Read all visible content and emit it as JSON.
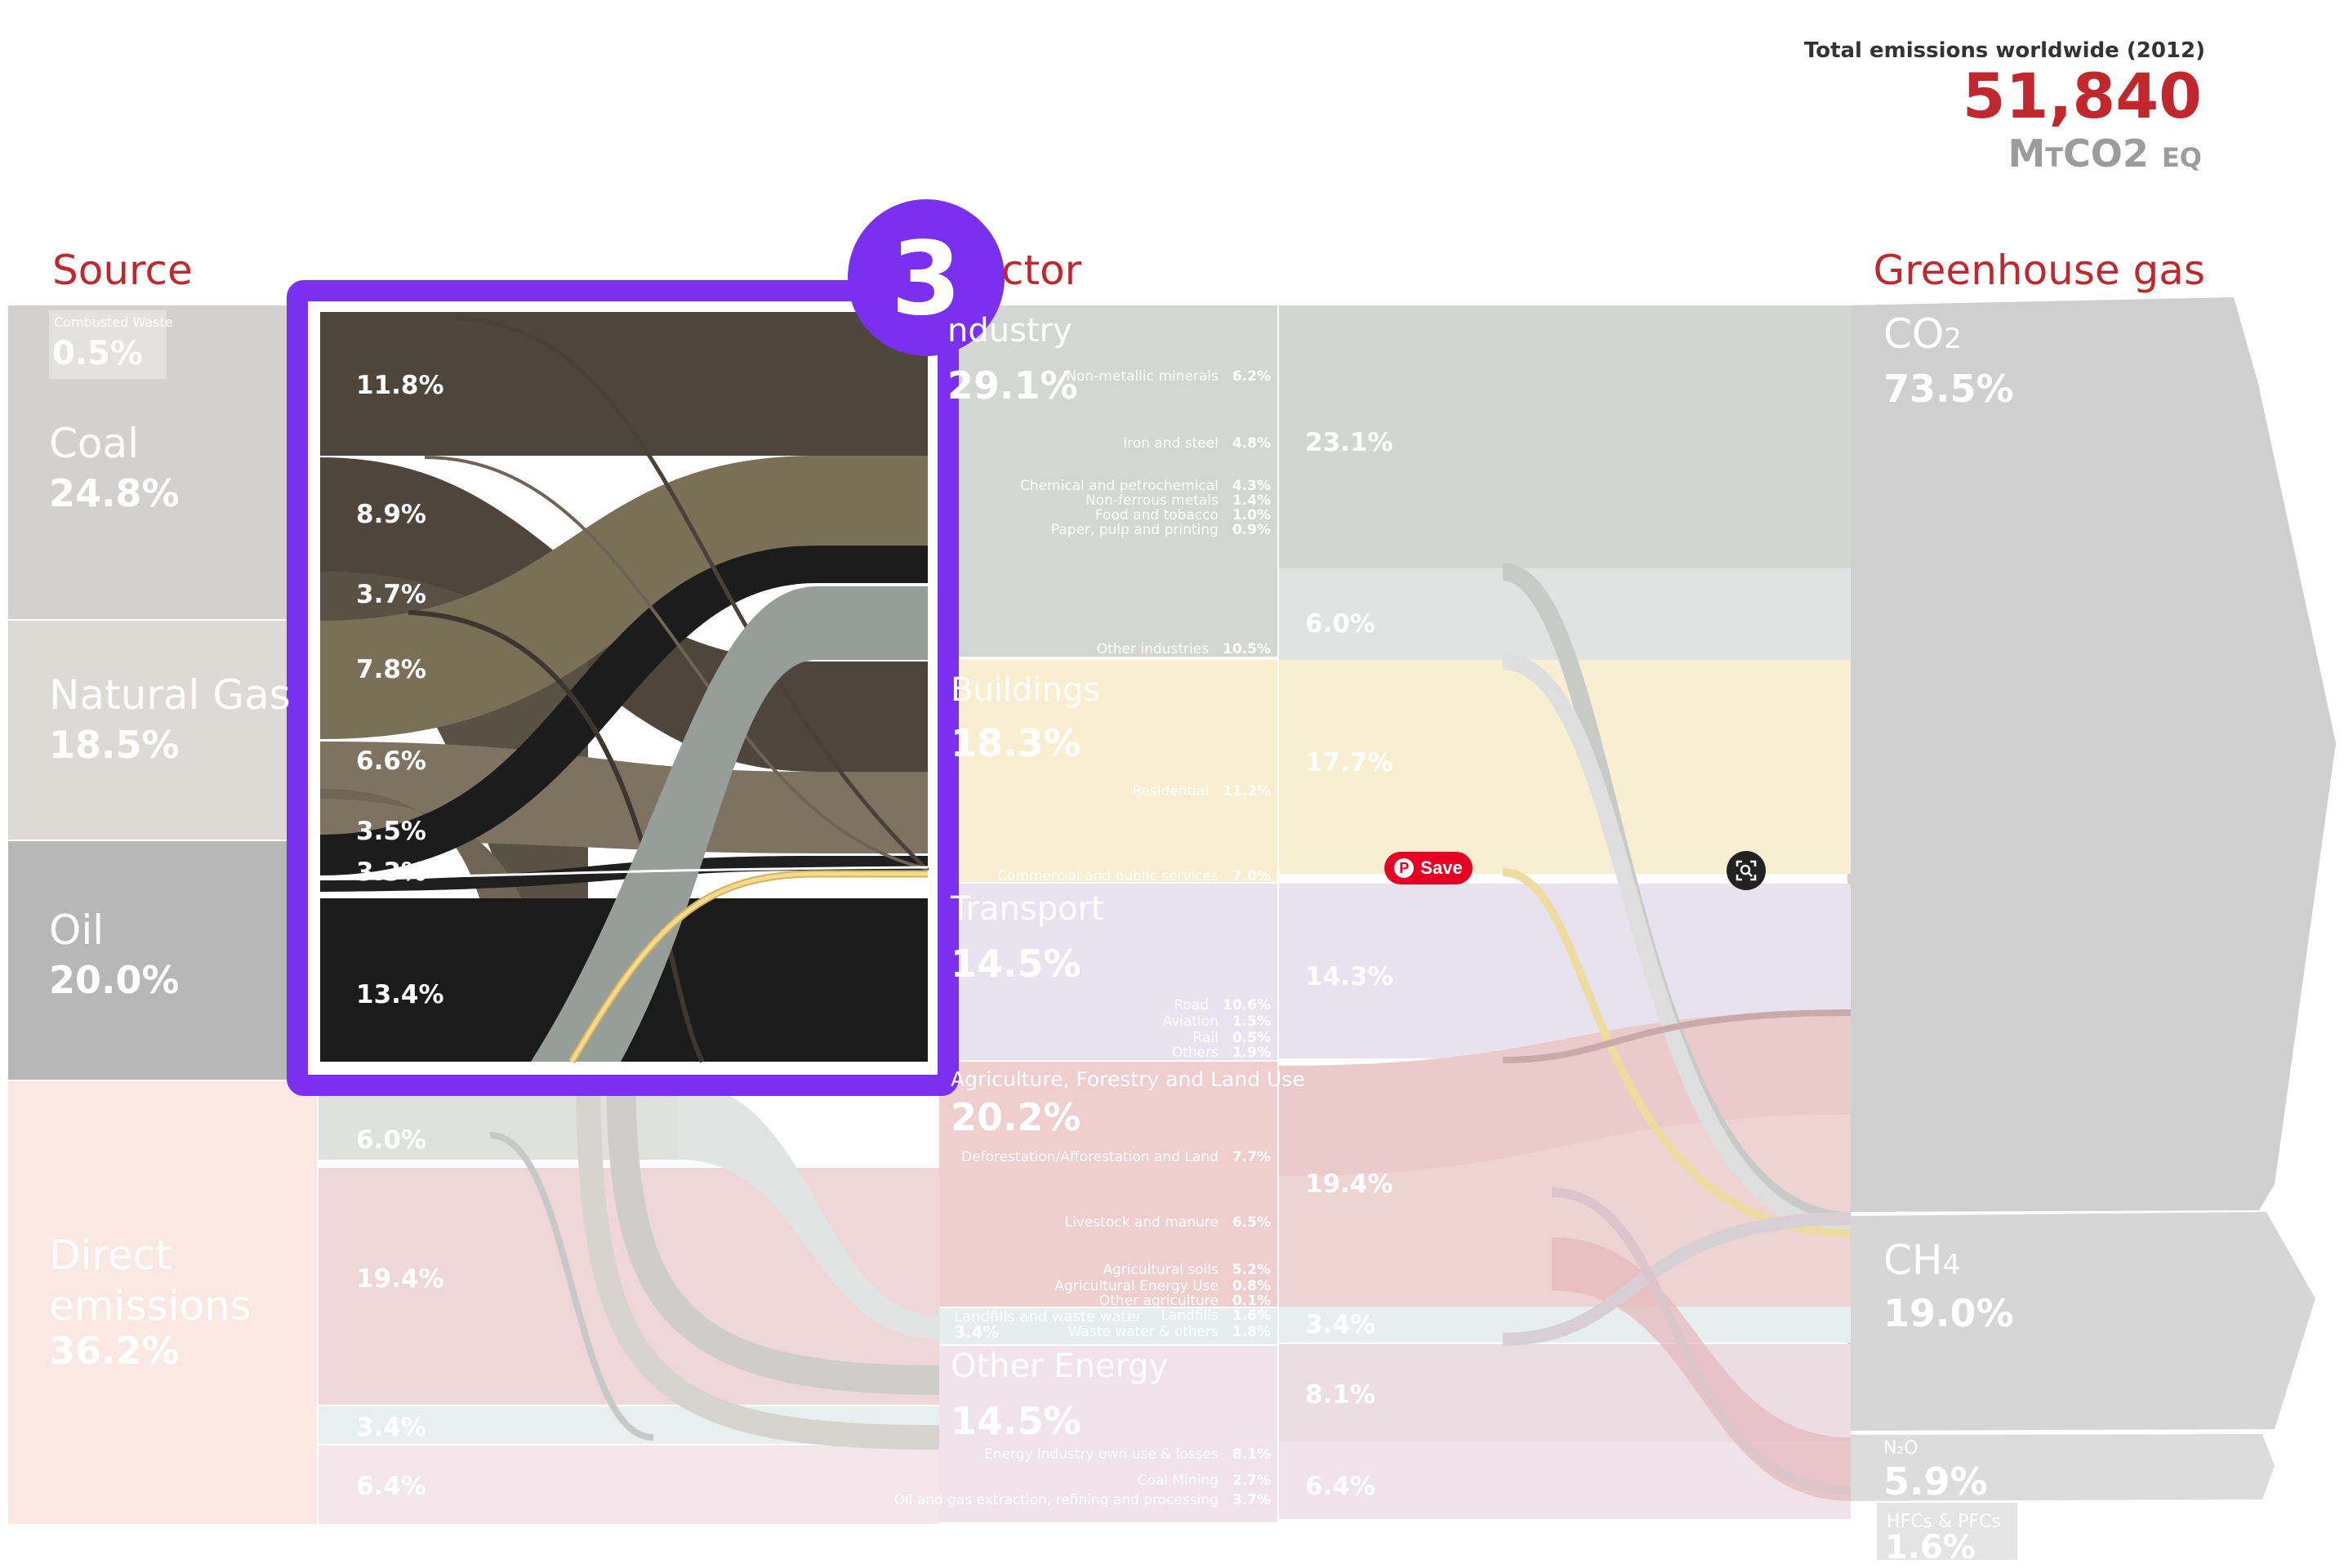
{
  "header": {
    "total_label": "Total emissions worldwide (2012)",
    "total_value": "51,840",
    "total_unit": "MtCO2 eq"
  },
  "columns": {
    "source": "Source",
    "sector": "ctor",
    "gas": "Greenhouse gas"
  },
  "step_badge": "3",
  "buttons": {
    "save": "Save"
  },
  "chart_data": {
    "type": "sankey",
    "title": "Total emissions worldwide (2012)",
    "total": 51840,
    "unit": "MtCO2 eq",
    "sources": [
      {
        "name": "Combusted Waste",
        "value": "0.5%"
      },
      {
        "name": "Coal",
        "value": "24.8%"
      },
      {
        "name": "Natural Gas",
        "value": "18.5%"
      },
      {
        "name": "Oil",
        "value": "20.0%"
      },
      {
        "name": "Direct emissions",
        "value": "36.2%"
      }
    ],
    "highlight_labels": [
      "11.8%",
      "8.9%",
      "3.7%",
      "7.8%",
      "6.6%",
      "3.5%",
      "3.3%",
      "13.4%"
    ],
    "direct_labels": [
      "6.0%",
      "19.4%",
      "3.4%",
      "6.4%"
    ],
    "sectors": [
      {
        "name": "Industry",
        "value": "29.1%",
        "subs": [
          {
            "name": "Non-metallic minerals",
            "value": "6.2%"
          },
          {
            "name": "Iron and steel",
            "value": "4.8%"
          },
          {
            "name": "Chemical and petrochemical",
            "value": "4.3%"
          },
          {
            "name": "Non-ferrous metals",
            "value": "1.4%"
          },
          {
            "name": "Food and tobacco",
            "value": "1.0%"
          },
          {
            "name": "Paper, pulp and printing",
            "value": "0.9%"
          },
          {
            "name": "Other industries",
            "value": "10.5%"
          }
        ]
      },
      {
        "name": "Buildings",
        "value": "18.3%",
        "subs": [
          {
            "name": "Residential",
            "value": "11.2%"
          },
          {
            "name": "Commercial and public services",
            "value": "7.0%"
          }
        ]
      },
      {
        "name": "Transport",
        "value": "14.5%",
        "subs": [
          {
            "name": "Road",
            "value": "10.6%"
          },
          {
            "name": "Aviation",
            "value": "1.5%"
          },
          {
            "name": "Rail",
            "value": "0.5%"
          },
          {
            "name": "Others",
            "value": "1.9%"
          }
        ]
      },
      {
        "name": "Agriculture, Forestry and Land Use",
        "value": "20.2%",
        "subs": [
          {
            "name": "Deforestation/Afforestation and Land",
            "value": "7.7%"
          },
          {
            "name": "Livestock and manure",
            "value": "6.5%"
          },
          {
            "name": "Agricultural soils",
            "value": "5.2%"
          },
          {
            "name": "Agricultural Energy Use",
            "value": "0.8%"
          },
          {
            "name": "Other agriculture",
            "value": "0.1%"
          }
        ]
      },
      {
        "name": "Landfills and waste water",
        "value": "3.4%",
        "subs": [
          {
            "name": "Landfills",
            "value": "1.6%"
          },
          {
            "name": "Waste water & others",
            "value": "1.8%"
          }
        ]
      },
      {
        "name": "Other Energy",
        "value": "14.5%",
        "subs": [
          {
            "name": "Energy industry own use & losses",
            "value": "8.1%"
          },
          {
            "name": "Coal Mining",
            "value": "2.7%"
          },
          {
            "name": "Oil and gas extraction, refining and processing",
            "value": "3.7%"
          }
        ]
      }
    ],
    "sector_gas_labels": [
      "23.1%",
      "6.0%",
      "17.7%",
      "14.3%",
      "19.4%",
      "3.4%",
      "8.1%",
      "6.4%"
    ],
    "gases": [
      {
        "name": "CO2",
        "value": "73.5%"
      },
      {
        "name": "CH4",
        "value": "19.0%"
      },
      {
        "name": "N2O",
        "value": "5.9%"
      },
      {
        "name": "HFCs & PFCs",
        "value": "1.6%"
      }
    ]
  }
}
